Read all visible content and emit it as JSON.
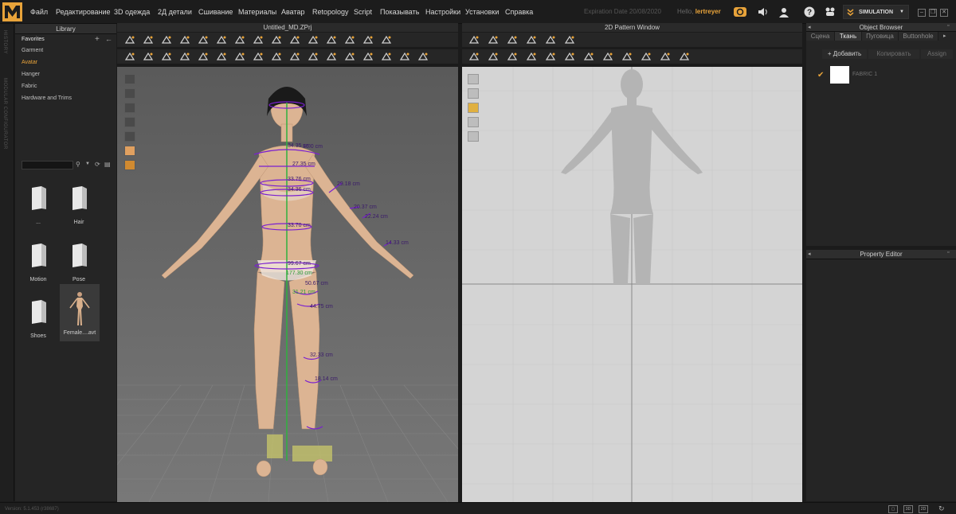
{
  "menubar": {
    "items": [
      "Файл",
      "Редактирование",
      "3D одежда",
      "2Д детали",
      "Сшивание",
      "Материалы",
      "Аватар",
      "Retopology",
      "Script",
      "Показывать",
      "Настройки",
      "Установки",
      "Справка"
    ],
    "expiry": "Expiration Date 20/08/2020",
    "hello_prefix": "Hello,",
    "username": "lertreyer",
    "simulation_label": "SIMULATION"
  },
  "vstrip": {
    "history": "HISTORY",
    "modular": "MODULAR CONFIGURATOR"
  },
  "library": {
    "title": "Library",
    "favorites": "Favorites",
    "items": [
      "Garment",
      "Avatar",
      "Hanger",
      "Fabric",
      "Hardware and Trims"
    ],
    "tiles": [
      "...",
      "Hair",
      "Motion",
      "Pose",
      "Shoes",
      "Female....avt"
    ]
  },
  "view3d": {
    "title": "Untitled_MD.ZPrj"
  },
  "view2d": {
    "title": "2D Pattern Window"
  },
  "object_browser": {
    "title": "Object Browser",
    "tabs": [
      "Сцена",
      "Ткань",
      "Пуговица",
      "Buttonhole"
    ],
    "add_button": "+ Добавить",
    "copy_button": "Копировать",
    "assign_button": "Assign",
    "fabric_name": "FABRIC 1"
  },
  "property_editor": {
    "title": "Property Editor"
  },
  "statusbar": {
    "version": "Version: 5.1.453 (r38687)"
  },
  "measurements": [
    "34.35 cm",
    "36.0 cm",
    "27.35 cm",
    "33.76 cm",
    "34.36 cm",
    "29.18 cm",
    "20.37 cm",
    "22.24 cm",
    "33.70 cm",
    "14.33 cm",
    "99.67 cm",
    "177.30 cm",
    "50.67 cm",
    "44.75 cm",
    "31.21 cm",
    "32.33 cm",
    "18.14 cm"
  ],
  "colors": {
    "accent": "#e8a33a",
    "measure": "#7a1fd0",
    "height_line": "#2fb13e"
  }
}
